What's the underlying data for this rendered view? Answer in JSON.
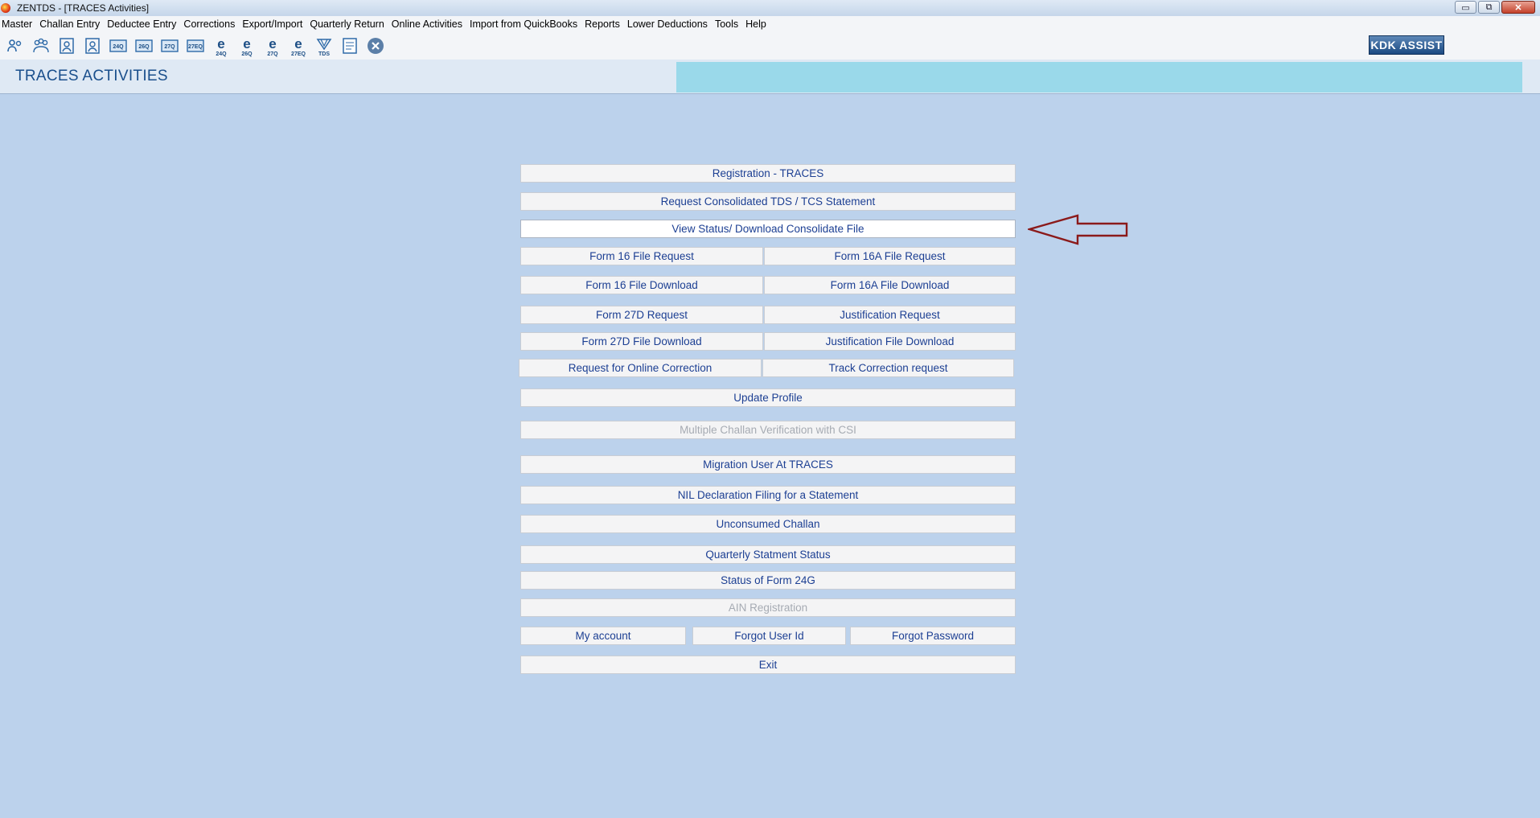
{
  "window": {
    "title": "ZENTDS - [TRACES Activities]",
    "controls": [
      "▭",
      "⧉",
      "✕"
    ]
  },
  "menu": [
    "Master",
    "Challan Entry",
    "Deductee Entry",
    "Corrections",
    "Export/Import",
    "Quarterly Return",
    "Online Activities",
    "Import from QuickBooks",
    "Reports",
    "Lower Deductions",
    "Tools",
    "Help"
  ],
  "toolbar": {
    "icons": [
      {
        "name": "users-icon",
        "label": ""
      },
      {
        "name": "group-icon",
        "label": ""
      },
      {
        "name": "person-card-icon",
        "label": ""
      },
      {
        "name": "person-card-icon",
        "label": ""
      },
      {
        "name": "form-24q-icon",
        "label": "24Q"
      },
      {
        "name": "form-26q-icon",
        "label": "26Q"
      },
      {
        "name": "form-27q-icon",
        "label": "27Q"
      },
      {
        "name": "form-27eq-icon",
        "label": "27EQ"
      },
      {
        "name": "e-24q-icon",
        "label": "24Q"
      },
      {
        "name": "e-26q-icon",
        "label": "26Q"
      },
      {
        "name": "e-27q-icon",
        "label": "27Q"
      },
      {
        "name": "e-27eq-icon",
        "label": "27EQ"
      },
      {
        "name": "tds-icon",
        "label": "TDS"
      },
      {
        "name": "document-icon",
        "label": ""
      },
      {
        "name": "close-circle-icon",
        "label": ""
      }
    ],
    "assist_label": "KDK ASSIST"
  },
  "header": {
    "title": "TRACES ACTIVITIES"
  },
  "buttons": {
    "registration": "Registration - TRACES",
    "request_consolidated": "Request Consolidated TDS / TCS Statement",
    "view_status": "View Status/ Download Consolidate File",
    "form16_request": "Form 16 File Request",
    "form16a_request": "Form 16A File Request",
    "form16_download": "Form 16 File Download",
    "form16a_download": "Form 16A File Download",
    "form27d_request": "Form 27D Request",
    "justification_request": "Justification Request",
    "form27d_download": "Form 27D File Download",
    "justification_download": "Justification File Download",
    "online_correction": "Request for Online Correction",
    "track_correction": "Track Correction request",
    "update_profile": "Update Profile",
    "multiple_challan": "Multiple Challan Verification with CSI",
    "migration_user": "Migration User At TRACES",
    "nil_declaration": "NIL Declaration Filing for a Statement",
    "unconsumed_challan": "Unconsumed Challan",
    "quarterly_status": "Quarterly Statment Status",
    "status_form24g": "Status of Form 24G",
    "ain_registration": "AIN Registration",
    "my_account": "My account",
    "forgot_user_id": "Forgot User Id",
    "forgot_password": "Forgot Password",
    "exit": "Exit"
  },
  "colors": {
    "background": "#bcd2ec",
    "header_band": "#9ad9ea",
    "button_text": "#1c3f93",
    "arrow": "#8b1a1a"
  }
}
